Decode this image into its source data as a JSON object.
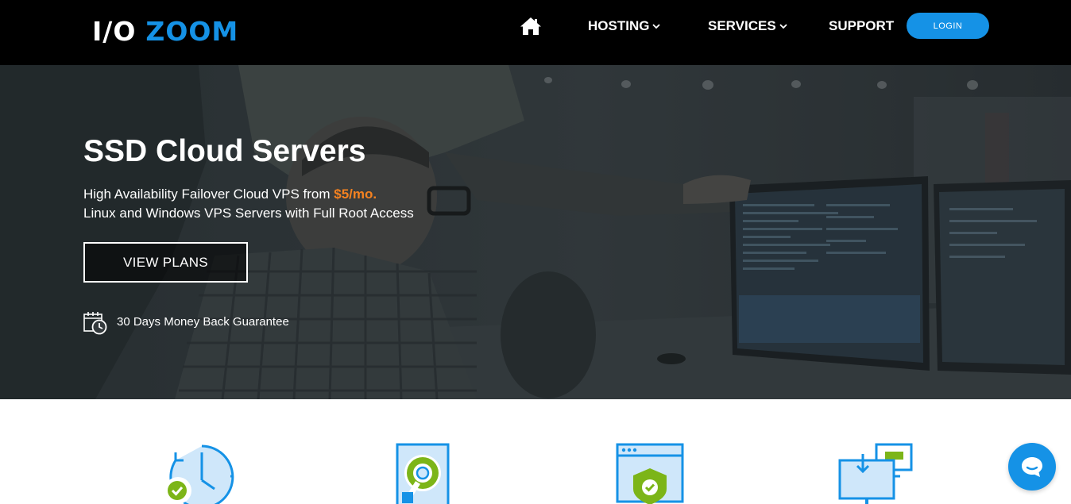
{
  "brand": {
    "part1": "I/O",
    "part2": "ZOOM"
  },
  "nav": {
    "home_icon": "home-icon",
    "items": [
      {
        "label": "HOSTING",
        "has_dropdown": true
      },
      {
        "label": "SERVICES",
        "has_dropdown": true
      },
      {
        "label": "SUPPORT",
        "has_dropdown": false
      }
    ],
    "login_label": "LOGIN"
  },
  "hero": {
    "title": "SSD Cloud Servers",
    "line1_prefix": "High Availability Failover Cloud VPS from ",
    "line1_price": "$5/mo.",
    "line2": "Linux and Windows VPS Servers with Full Root Access",
    "cta_label": "VIEW PLANS",
    "guarantee_icon": "calendar-clock-icon",
    "guarantee_text": "30 Days Money Back Guarantee"
  },
  "features": {
    "icons": [
      "clock-check-icon",
      "hard-drive-icon",
      "shield-browser-icon",
      "download-monitor-icon"
    ]
  },
  "chat": {
    "icon": "chat-bubble-icon"
  },
  "colors": {
    "nav_bg": "#000000",
    "brand_blue": "#1592e6",
    "price_orange": "#f58220",
    "icon_green": "#7cb518"
  }
}
